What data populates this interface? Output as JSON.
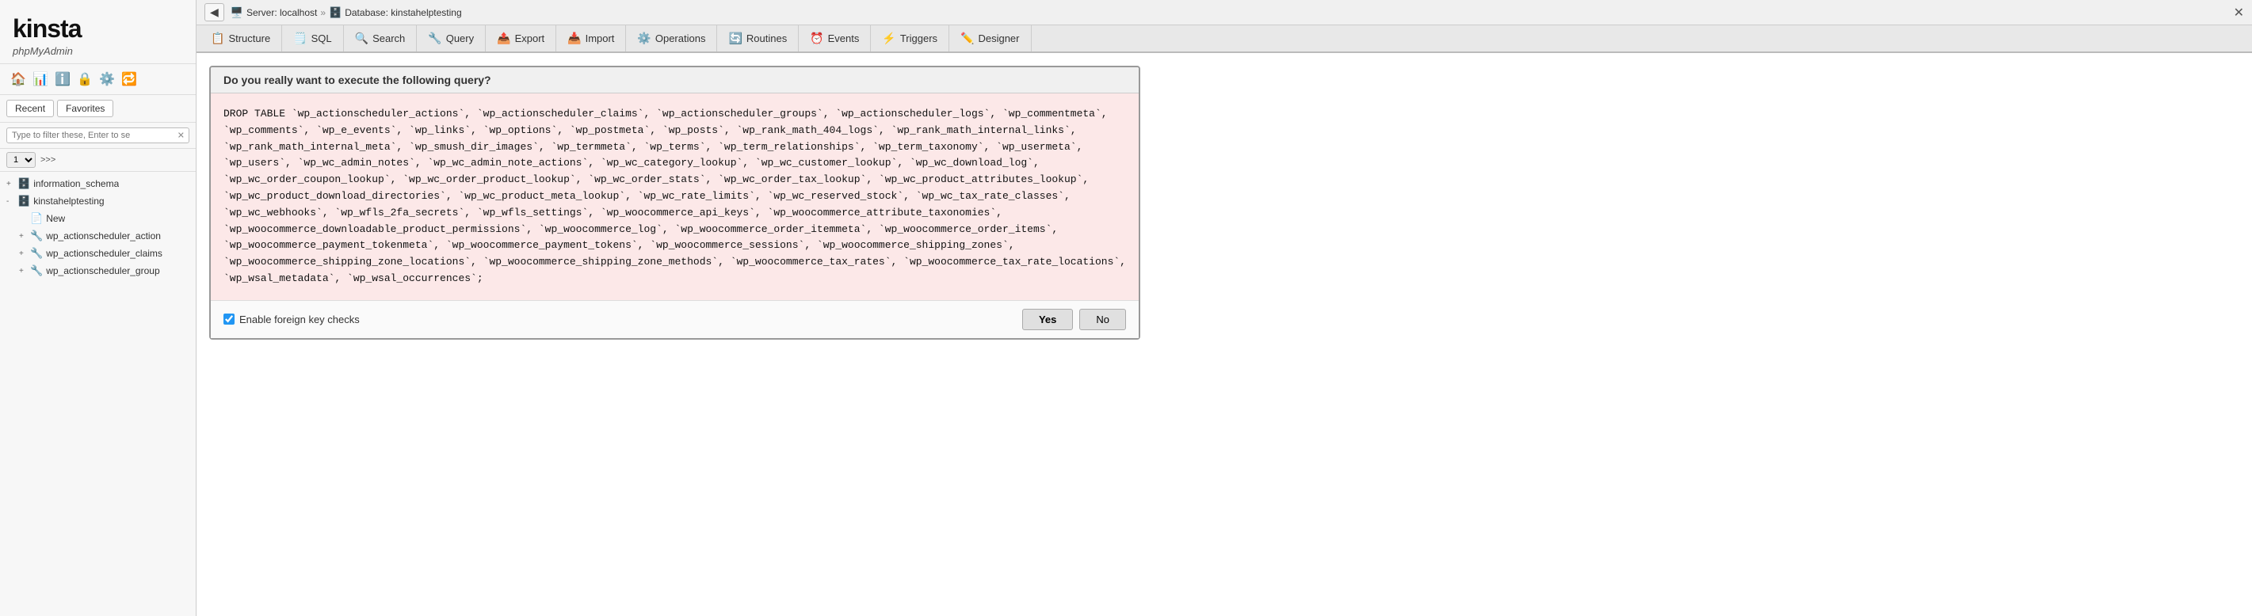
{
  "sidebar": {
    "logo": "kinsta",
    "subtitle": "phpMyAdmin",
    "nav_icons": [
      "🏠",
      "📊",
      "ℹ️",
      "🔒",
      "⚙️"
    ],
    "tabs": [
      {
        "label": "Recent",
        "active": false
      },
      {
        "label": "Favorites",
        "active": false
      }
    ],
    "filter_placeholder": "Type to filter these, Enter to se",
    "pagination": {
      "page": "1",
      "arrows": ">>>"
    },
    "tree": [
      {
        "label": "information_schema",
        "icon": "🗄️",
        "expanded": false,
        "level": 0,
        "expand": "+"
      },
      {
        "label": "kinstahelptesting",
        "icon": "🗄️",
        "expanded": true,
        "level": 0,
        "expand": "-"
      },
      {
        "label": "New",
        "icon": "📄",
        "level": 1,
        "expand": ""
      },
      {
        "label": "wp_actionscheduler_action",
        "icon": "🔧",
        "level": 1,
        "expand": "+"
      },
      {
        "label": "wp_actionscheduler_claims",
        "icon": "🔧",
        "level": 1,
        "expand": "+"
      },
      {
        "label": "wp_actionscheduler_group",
        "icon": "🔧",
        "level": 1,
        "expand": "+"
      }
    ]
  },
  "topbar": {
    "back_label": "◀",
    "server_label": "Server: localhost",
    "separator": "»",
    "db_label": "Database: kinstahelptesting",
    "close_label": "✕"
  },
  "tabs": [
    {
      "label": "Structure",
      "icon": "📋"
    },
    {
      "label": "SQL",
      "icon": "🗒️"
    },
    {
      "label": "Search",
      "icon": "🔍"
    },
    {
      "label": "Query",
      "icon": "🔧"
    },
    {
      "label": "Export",
      "icon": "📤"
    },
    {
      "label": "Import",
      "icon": "📥"
    },
    {
      "label": "Operations",
      "icon": "⚙️"
    },
    {
      "label": "Routines",
      "icon": "🔄"
    },
    {
      "label": "Events",
      "icon": "⏰"
    },
    {
      "label": "Triggers",
      "icon": "⚡"
    },
    {
      "label": "Designer",
      "icon": "✏️"
    }
  ],
  "confirm": {
    "header": "Do you really want to execute the following query?",
    "query": "DROP TABLE `wp_actionscheduler_actions`, `wp_actionscheduler_claims`, `wp_actionscheduler_groups`, `wp_actionscheduler_logs`, `wp_commentmeta`,\n`wp_comments`, `wp_e_events`, `wp_links`, `wp_options`, `wp_postmeta`, `wp_posts`, `wp_rank_math_404_logs`, `wp_rank_math_internal_links`,\n`wp_rank_math_internal_meta`, `wp_smush_dir_images`, `wp_termmeta`, `wp_terms`, `wp_term_relationships`, `wp_term_taxonomy`, `wp_usermeta`,\n`wp_users`, `wp_wc_admin_notes`, `wp_wc_admin_note_actions`, `wp_wc_category_lookup`, `wp_wc_customer_lookup`, `wp_wc_download_log`,\n`wp_wc_order_coupon_lookup`, `wp_wc_order_product_lookup`, `wp_wc_order_stats`, `wp_wc_order_tax_lookup`, `wp_wc_product_attributes_lookup`,\n`wp_wc_product_download_directories`, `wp_wc_product_meta_lookup`, `wp_wc_rate_limits`, `wp_wc_reserved_stock`, `wp_wc_tax_rate_classes`,\n`wp_wc_webhooks`, `wp_wfls_2fa_secrets`, `wp_wfls_settings`, `wp_woocommerce_api_keys`, `wp_woocommerce_attribute_taxonomies`,\n`wp_woocommerce_downloadable_product_permissions`, `wp_woocommerce_log`, `wp_woocommerce_order_itemmeta`, `wp_woocommerce_order_items`,\n`wp_woocommerce_payment_tokenmeta`, `wp_woocommerce_payment_tokens`, `wp_woocommerce_sessions`, `wp_woocommerce_shipping_zones`,\n`wp_woocommerce_shipping_zone_locations`, `wp_woocommerce_shipping_zone_methods`, `wp_woocommerce_tax_rates`, `wp_woocommerce_tax_rate_locations`,\n`wp_wsal_metadata`, `wp_wsal_occurrences`;",
    "foreign_key_label": "Enable foreign key checks",
    "yes_label": "Yes",
    "no_label": "No"
  }
}
